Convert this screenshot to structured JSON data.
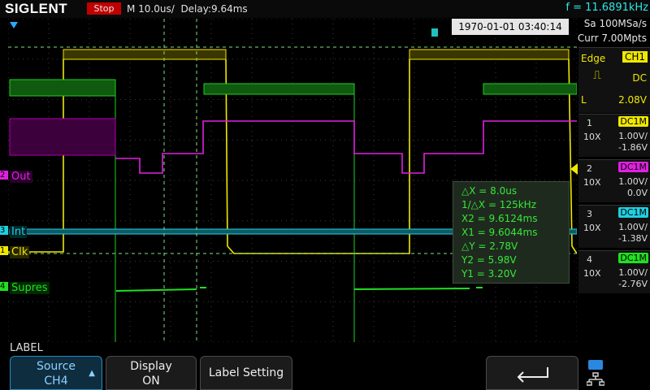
{
  "header": {
    "brand": "SIGLENT",
    "run_state": "Stop",
    "timebase": "M 10.0us/",
    "delay": "Delay:9.64ms",
    "frequency": "f = 11.6891kHz",
    "sample_rate": "Sa 100MSa/s",
    "current_points": "Curr 7.00Mpts",
    "datetime": "1970-01-01 03:40:14"
  },
  "trigger": {
    "mode": "Edge",
    "source": "CH1",
    "coupling": "DC",
    "level_label": "L",
    "level": "2.08V"
  },
  "channels": [
    {
      "num": "1",
      "coupling": "DC1M",
      "probe": "10X",
      "scale": "1.00V/",
      "offset": "-1.86V",
      "color": "#f0e800"
    },
    {
      "num": "2",
      "coupling": "DC1M",
      "probe": "10X",
      "scale": "1.00V/",
      "offset": "0.0V",
      "color": "#e020e0"
    },
    {
      "num": "3",
      "coupling": "DC1M",
      "probe": "10X",
      "scale": "1.00V/",
      "offset": "-1.38V",
      "color": "#20d0e0"
    },
    {
      "num": "4",
      "coupling": "DC1M",
      "probe": "10X",
      "scale": "1.00V/",
      "offset": "-2.76V",
      "color": "#20e020"
    }
  ],
  "waveform_labels": {
    "ch2": "Out",
    "ch3": "Int",
    "ch1": "Clk",
    "ch4": "Supres"
  },
  "measurement": {
    "dx": "△X = 8.0us",
    "inv_dx": "1/△X = 125kHz",
    "x2": "X2 = 9.6124ms",
    "x1": "X1 = 9.6044ms",
    "dy": "△Y = 2.78V",
    "y2": "Y2 = 5.98V",
    "y1": "Y1 = 3.20V"
  },
  "menu": {
    "title": "LABEL",
    "source_label": "Source",
    "source_value": "CH4",
    "display_label": "Display",
    "display_value": "ON",
    "label_setting": "Label Setting"
  }
}
